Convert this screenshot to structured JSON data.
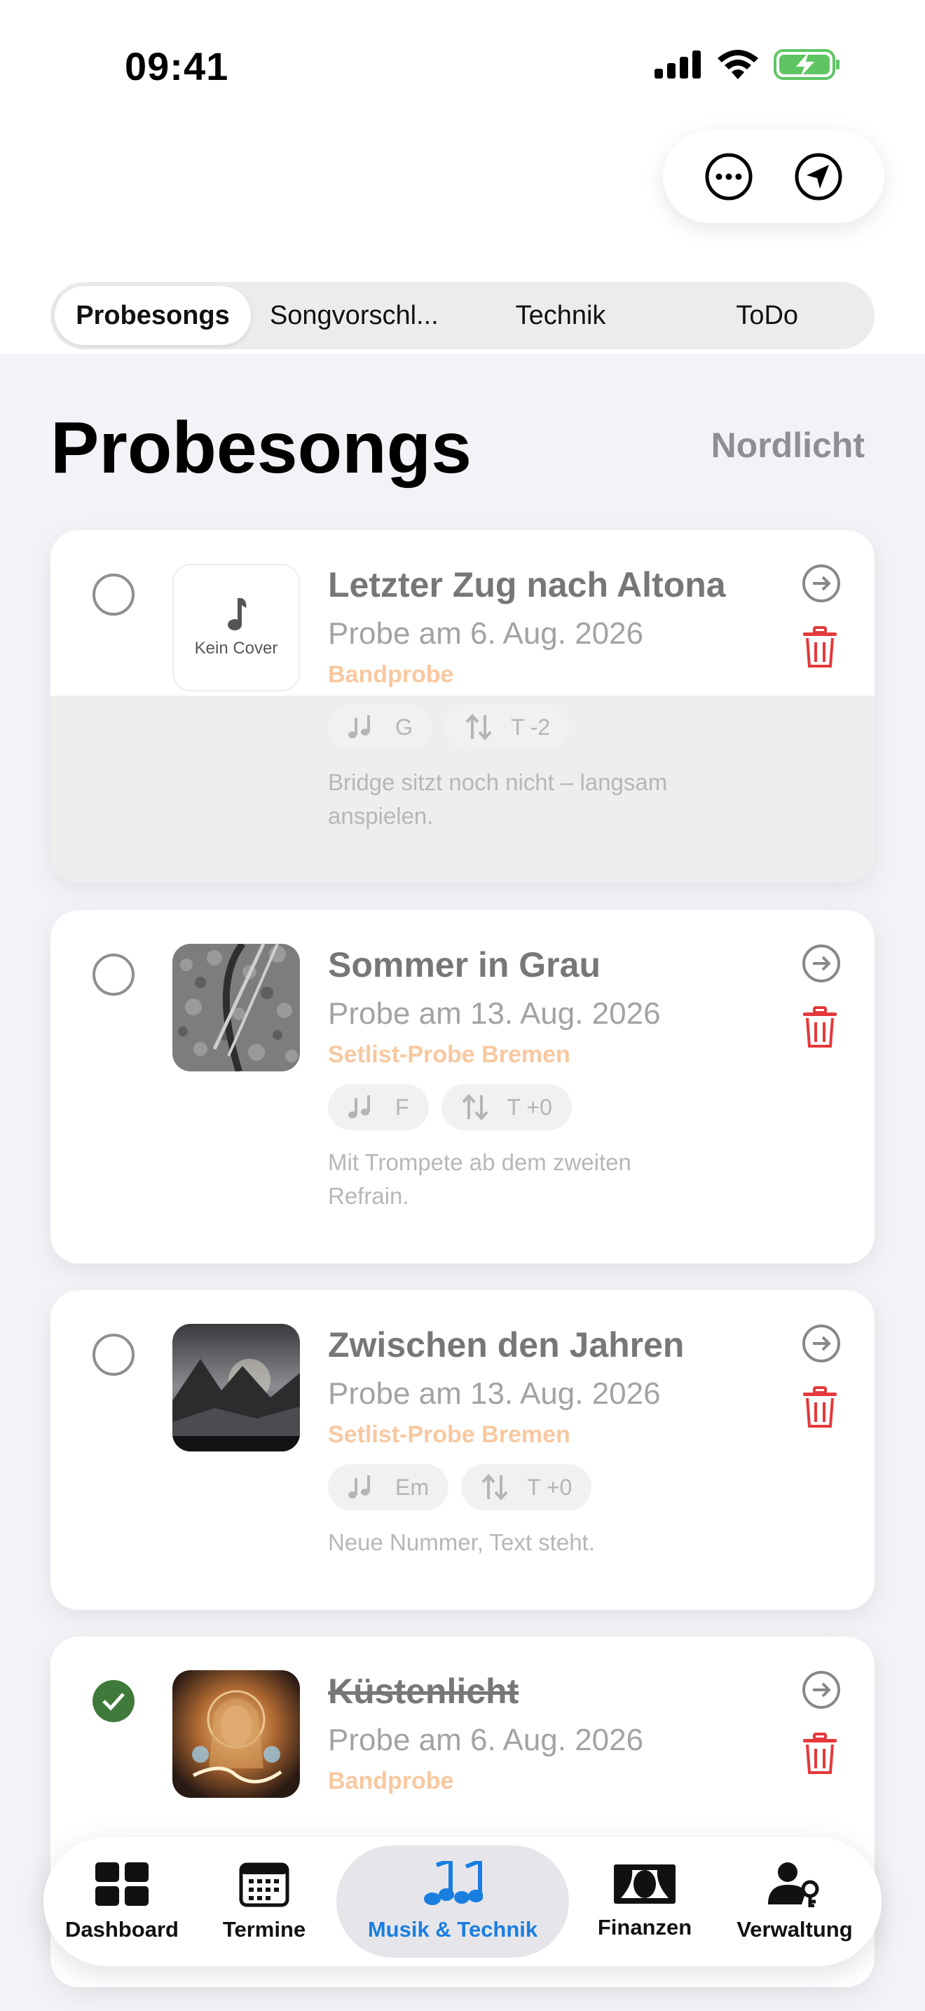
{
  "status_bar": {
    "time": "09:41"
  },
  "colors": {
    "accent": "#1a7ee0",
    "delete": "#e5383b",
    "done": "#3f7a3a",
    "event": "#f8c8a0"
  },
  "header_actions": [
    {
      "icon": "ellipsis-circle-icon"
    },
    {
      "icon": "paperplane-circle-icon"
    }
  ],
  "segments": {
    "selected": "Probesongs",
    "items": [
      "Probesongs",
      "Songvorschl...",
      "Technik",
      "ToDo"
    ]
  },
  "page": {
    "title": "Probesongs",
    "band": "Nordlicht"
  },
  "songs": [
    {
      "title": "Letzter Zug nach Altona",
      "probe": "Probe am 6. Aug. 2026",
      "event": "Bandprobe",
      "key": "G",
      "transpose": "T -2",
      "note_line1": "Bridge sitzt noch nicht – langsam",
      "note_line2": "anspielen.",
      "cover": "Kein Cover",
      "done": false
    },
    {
      "title": "Sommer in Grau",
      "probe": "Probe am 13. Aug. 2026",
      "event": "Setlist-Probe Bremen",
      "key": "F",
      "transpose": "T +0",
      "note_line1": "Mit Trompete ab dem zweiten",
      "note_line2": "Refrain.",
      "done": false
    },
    {
      "title": "Zwischen den Jahren",
      "probe": "Probe am 13. Aug. 2026",
      "event": "Setlist-Probe Bremen",
      "key": "Em",
      "transpose": "T +0",
      "note_line1": "Neue Nummer, Text steht.",
      "done": false
    },
    {
      "title": "Küstenlicht",
      "probe": "Probe am 6. Aug. 2026",
      "event": "Bandprobe",
      "done": true
    }
  ],
  "tabbar": {
    "selected": "Musik & Technik",
    "items": [
      {
        "label": "Dashboard",
        "icon": "grid-icon"
      },
      {
        "label": "Termine",
        "icon": "calendar-icon"
      },
      {
        "label": "Musik & Technik",
        "icon": "music-notes-icon"
      },
      {
        "label": "Finanzen",
        "icon": "banknote-icon"
      },
      {
        "label": "Verwaltung",
        "icon": "person-key-icon"
      }
    ]
  }
}
